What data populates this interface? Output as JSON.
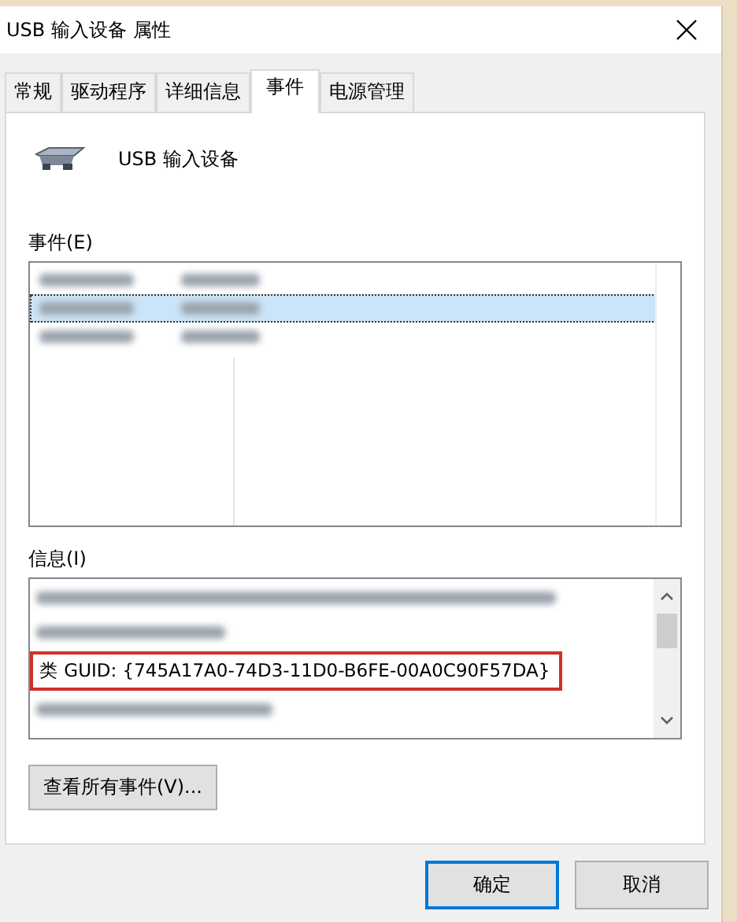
{
  "window": {
    "title": "USB 输入设备 属性"
  },
  "tabs": [
    {
      "label": "常规",
      "selected": false
    },
    {
      "label": "驱动程序",
      "selected": false
    },
    {
      "label": "详细信息",
      "selected": false
    },
    {
      "label": "事件",
      "selected": true
    },
    {
      "label": "电源管理",
      "selected": false
    }
  ],
  "device": {
    "name": "USB 输入设备"
  },
  "events": {
    "label": "事件(E)",
    "rows": [
      {
        "selected": false
      },
      {
        "selected": true
      },
      {
        "selected": false
      }
    ]
  },
  "info": {
    "label": "信息(I)",
    "guid_line": "类 GUID: {745A17A0-74D3-11D0-B6FE-00A0C90F57DA}",
    "highlighted": true
  },
  "view_all_button": "查看所有事件(V)...",
  "buttons": [
    {
      "label": "确定",
      "default": true
    },
    {
      "label": "取消",
      "default": false
    }
  ]
}
